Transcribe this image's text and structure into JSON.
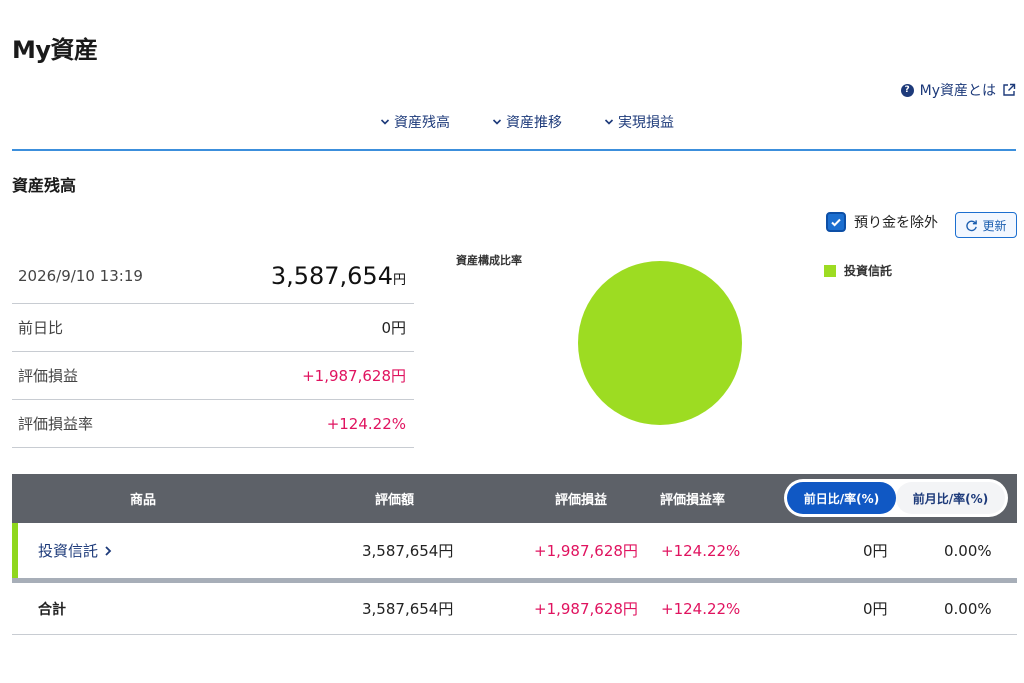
{
  "page": {
    "title": "My資産",
    "help_label": "My資産とは"
  },
  "nav": {
    "items": [
      {
        "label": "資産残高"
      },
      {
        "label": "資産推移"
      },
      {
        "label": "実現損益"
      }
    ]
  },
  "section": {
    "title": "資産残高",
    "exclude_label": "預り金を除外",
    "exclude_checked": true,
    "refresh_label": "更新"
  },
  "summary": {
    "datetime": "2026/9/10 13:19",
    "total_value": "3,587,654",
    "total_unit": "円",
    "rows": [
      {
        "label": "前日比",
        "value": "0円"
      },
      {
        "label": "評価損益",
        "value": "+1,987,628円"
      },
      {
        "label": "評価損益率",
        "value": "+124.22%"
      }
    ]
  },
  "chart_data": {
    "type": "pie",
    "title": "資産構成比率",
    "legend_position": "right",
    "categories": [
      "投資信託"
    ],
    "values": [
      100
    ],
    "colors": [
      "#9ddc22"
    ]
  },
  "table": {
    "headers": {
      "product": "商品",
      "valuation": "評価額",
      "gain": "評価損益",
      "gain_rate": "評価損益率"
    },
    "toggle": {
      "day": "前日比/率(%)",
      "month": "前月比/率(%)"
    },
    "rows": [
      {
        "name": "投資信託",
        "valuation": "3,587,654円",
        "gain": "+1,987,628円",
        "gain_rate": "+124.22%",
        "diff": "0円",
        "diff_rate": "0.00%"
      }
    ],
    "total": {
      "name": "合計",
      "valuation": "3,587,654円",
      "gain": "+1,987,628円",
      "gain_rate": "+124.22%",
      "diff": "0円",
      "diff_rate": "0.00%"
    }
  },
  "colors": {
    "accent": "#1058c4",
    "link": "#1d3a7a",
    "positive": "#e0135f",
    "fund": "#8fd71d",
    "divider": "#3c8fdc"
  }
}
